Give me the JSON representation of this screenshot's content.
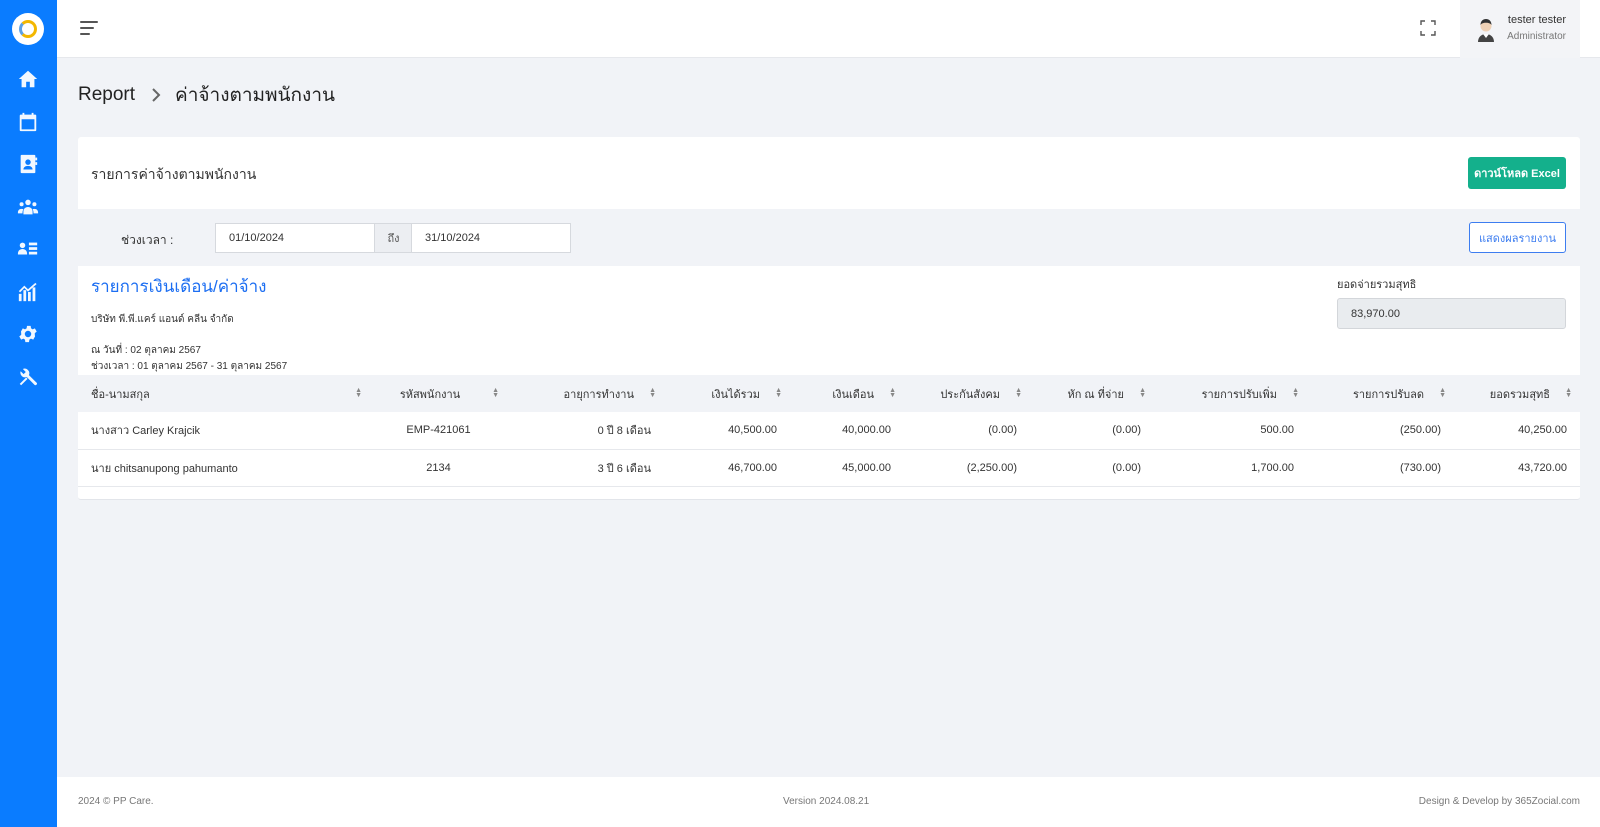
{
  "sidebar": {
    "items": [
      {
        "name": "home-icon"
      },
      {
        "name": "payroll-calendar-icon"
      },
      {
        "name": "contacts-icon"
      },
      {
        "name": "team-icon"
      },
      {
        "name": "employee-list-icon"
      },
      {
        "name": "report-chart-icon"
      },
      {
        "name": "settings-gear-icon"
      },
      {
        "name": "tools-icon"
      }
    ],
    "accent": "#0a7cff"
  },
  "topbar": {
    "user_name": "tester tester",
    "user_role": "Administrator"
  },
  "breadcrumb": {
    "root": "Report",
    "current": "ค่าจ้างตามพนักงาน"
  },
  "card": {
    "title": "รายการค่าจ้างตามพนักงาน",
    "excel_button": "ดาวน์โหลด Excel"
  },
  "filter": {
    "label": "ช่วงเวลา :",
    "start_date": "01/10/2024",
    "separator": "ถึง",
    "end_date": "31/10/2024",
    "show_button": "แสดงผลรายงาน"
  },
  "report": {
    "title": "รายการเงินเดือน/ค่าจ้าง",
    "company": "บริษัท พี.พี.แคร์ แอนด์ คลีน จำกัด",
    "as_of": "ณ วันที่ : 02 ตุลาคม 2567",
    "period": "ช่วงเวลา : 01 ตุลาคม 2567 - 31 ตุลาคม 2567",
    "net_label": "ยอดจ่ายรวมสุทธิ",
    "net_value": "83,970.00"
  },
  "table": {
    "headers": [
      "ชื่อ-นามสกุล",
      "รหัสพนักงาน",
      "อายุการทำงาน",
      "เงินได้รวม",
      "เงินเดือน",
      "ประกันสังคม",
      "หัก ณ ที่จ่าย",
      "รายการปรับเพิ่ม",
      "รายการปรับลด",
      "ยอดรวมสุทธิ"
    ],
    "rows": [
      [
        "นางสาว Carley Krajcik",
        "EMP-421061",
        "0 ปี 8 เดือน",
        "40,500.00",
        "40,000.00",
        "(0.00)",
        "(0.00)",
        "500.00",
        "(250.00)",
        "40,250.00"
      ],
      [
        "นาย chitsanupong pahumanto",
        "2134",
        "3 ปี 6 เดือน",
        "46,700.00",
        "45,000.00",
        "(2,250.00)",
        "(0.00)",
        "1,700.00",
        "(730.00)",
        "43,720.00"
      ]
    ]
  },
  "footer": {
    "copyright": "2024 © PP Care.",
    "version": "Version 2024.08.21",
    "credit": "Design & Develop by 365Zocial.com"
  }
}
